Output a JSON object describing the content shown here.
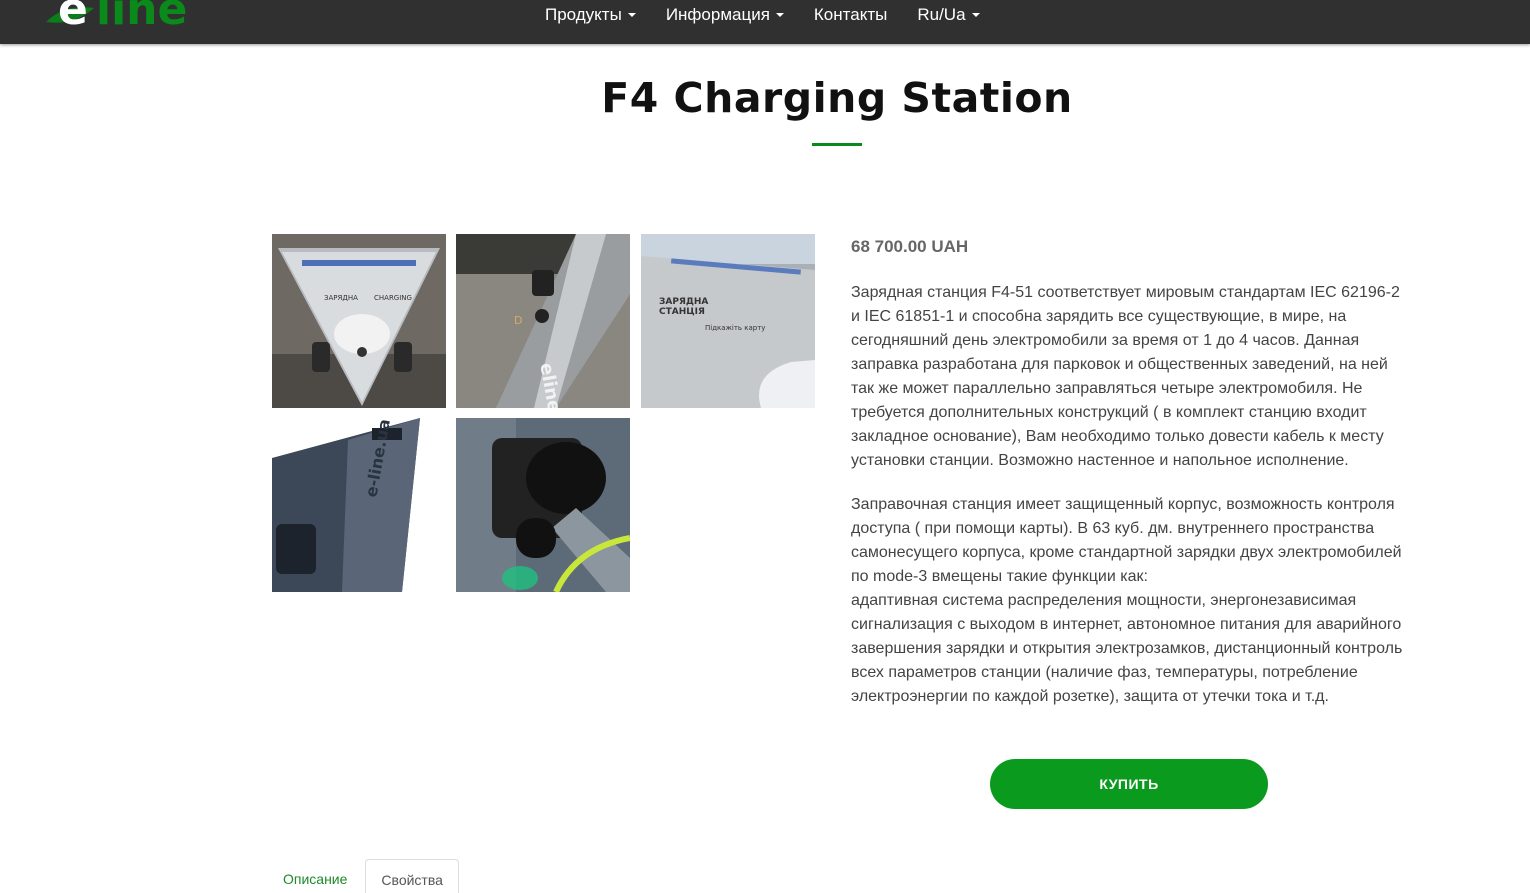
{
  "brand": {
    "logo_text": "eline",
    "brand_color": "#0a8a1a"
  },
  "nav": {
    "items": [
      {
        "label": "Продукты",
        "dropdown": true
      },
      {
        "label": "Информация",
        "dropdown": true
      },
      {
        "label": "Контакты",
        "dropdown": false
      },
      {
        "label": "Ru/Ua",
        "dropdown": true
      }
    ]
  },
  "product": {
    "title": "F4 Charging Station",
    "price": "68 700.00 UAH",
    "description_p1": [
      "Зарядная станция F4-51 соответствует мировым стандартам IEC 62196-2",
      "и IEC 61851-1 и способна зарядить все существующие, в мире, на",
      "сегодняшний день электромобили за время от 1 до 4 часов. Данная",
      "заправка разработана для парковок и общественных заведений, на ней",
      "так же может параллельно заправляться четыре электромобиля. Не",
      "требуется дополнительных конструкций ( в комплект станцию входит",
      "закладное основание), Вам необходимо только довести кабель к месту",
      "установки станции. Возможно настенное и напольное исполнение."
    ],
    "description_p2": [
      "Заправочная станция имеет защищенный корпус, возможность контроля",
      "доступа ( при помощи карты). В 63 куб. дм. внутреннего пространства",
      "самонесущего корпуса, кроме стандартной зарядки двух электромобилей",
      "по mode-3 вмещены такие функции как:",
      "адаптивная система распределения мощности, энергонезависимая",
      "сигнализация с выходом в интернет, автономное питания для аварийного",
      "завершения зарядки и открытия электрозамков, дистанционный контроль",
      "всех параметров станции (наличие фаз, температуры, потребление",
      "электроэнергии по каждой розетке), защита от утечки тока и т.д."
    ],
    "buy_label": "КУПИТЬ",
    "buy_color": "#0a9a1e",
    "gallery": [
      {
        "name": "photo-triangle-top"
      },
      {
        "name": "photo-side-edge"
      },
      {
        "name": "photo-panel-closeup"
      },
      {
        "name": "photo-eline-side"
      },
      {
        "name": "photo-plug-connected"
      }
    ]
  },
  "tabs": [
    {
      "label": "Описание",
      "active": false
    },
    {
      "label": "Свойства",
      "active": true
    }
  ]
}
